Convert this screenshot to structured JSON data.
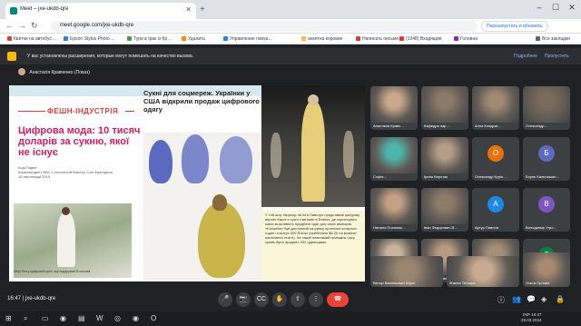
{
  "browser": {
    "tab_title": "Meet – jxe-ukdb-qre",
    "url": "meet.google.com/jxe-ukdb-qre",
    "update_label": "Перезапустить и обновить",
    "bookmarks": [
      {
        "label": "Квитки на автобус…",
        "color": "#e53935"
      },
      {
        "label": "Epson Stylus Photo…",
        "color": "#1e88e5"
      },
      {
        "label": "Тури в Ірак із Кр…",
        "color": "#43a047"
      },
      {
        "label": "Удалить",
        "color": "#fb8c00"
      },
      {
        "label": "Управление папка…",
        "color": "#1e88e5"
      },
      {
        "label": "анкетна коровин",
        "color": "#fbc02d"
      },
      {
        "label": "Написать письмо",
        "color": "#e53935"
      },
      {
        "label": "(1048) Входящие",
        "color": "#e53935"
      },
      {
        "label": "Головна",
        "color": "#8e24aa"
      },
      {
        "label": "Все закладки",
        "color": "#5f6368"
      }
    ]
  },
  "meet": {
    "info_text": "У вас установлены расширения, которые могут помешать на качество вызова.",
    "info_link1": "Подробнее",
    "info_link2": "Пропустить",
    "presenter": "Анастасія Кравченко (Показ)",
    "time_code": "16:47  |  jxe-ukdb-qre"
  },
  "slide": {
    "section": "ФЕШН-ІНДУСТРІЯ",
    "headline": "Цифрова мода: 10 тисяч доларів за сукню, якої не існує",
    "author": "Коді Годвін\nКореспондент BBC з технологій бізнесу, Сан Франциско\n16 листопада 2019",
    "caption_left": "Мері Рен у цифровій сукні, яку подарував їй чоловік",
    "sub_headline": "Сукні для соцмереж. Українки у США відкрили продаж цифрового одягу",
    "textbox": "У той шоу творець на їм'я Павстун представив цифрову версію Карлі в сукні з квітами в Roblox, де користувачі мали можливість придбати одяг для своїх аватарів. «Kossette» був доступний на ринку протягом чотирьох годин і коштує 500 Robux (приблизно $6.25 на момент написання статті). За такий невеликий проміжок часу сукню було продано 432 одиницями."
  },
  "participants": [
    {
      "name": "Анастасія Кравч…",
      "initial": "",
      "color": "",
      "photo": "#c9a98a"
    },
    {
      "name": "Кафедра нар…",
      "initial": "",
      "color": "",
      "photo": "#8b7a66"
    },
    {
      "name": "Анна Кондрат…",
      "initial": "",
      "color": "",
      "photo": "#a08a72"
    },
    {
      "name": "Олександр…",
      "initial": "",
      "color": "",
      "photo": "#7a6b5a"
    },
    {
      "name": "Софія…",
      "initial": "",
      "color": "",
      "photo": "#4db6ac"
    },
    {
      "name": "Ірина Верстак",
      "initial": "",
      "color": "",
      "photo": "#b39d86"
    },
    {
      "name": "Олександр Курін…",
      "initial": "О",
      "color": "#e8710a",
      "photo": ""
    },
    {
      "name": "Борис Кальнишан…",
      "initial": "Б",
      "color": "#5c6bc0",
      "photo": ""
    },
    {
      "name": "Наталія Похилюк…",
      "initial": "",
      "color": "",
      "photo": "#c4a083"
    },
    {
      "name": "Іван Федорович В…",
      "initial": "",
      "color": "",
      "photo": "#8d7b6a"
    },
    {
      "name": "Артур Павлов",
      "initial": "А",
      "color": "#1e88e5",
      "photo": ""
    },
    {
      "name": "Володимир Угро…",
      "initial": "В",
      "color": "#7e57c2",
      "photo": ""
    },
    {
      "name": "Марго Путилінко",
      "initial": "",
      "color": "",
      "photo": "#c8b49c"
    },
    {
      "name": "Олена Іванівна К…",
      "initial": "",
      "color": "",
      "photo": "#b89a80"
    },
    {
      "name": "Кафедра образо…",
      "initial": "",
      "color": "",
      "photo": "#a58e77"
    },
    {
      "name": "Галина Молчанова",
      "initial": "Г",
      "color": "#0b8043",
      "photo": ""
    },
    {
      "name": "Віктор Васильович Кароткі",
      "initial": "",
      "color": "",
      "photo": "#9a8570"
    },
    {
      "name": "Жанна Тетьора",
      "initial": "",
      "color": "",
      "photo": "#c7aa90"
    },
    {
      "name": "Ольга Орлова",
      "initial": "",
      "color": "",
      "photo": "#a6896f"
    }
  ],
  "taskbar": {
    "lang": "УКР",
    "time": "16:47",
    "date": "29.03.2024"
  }
}
